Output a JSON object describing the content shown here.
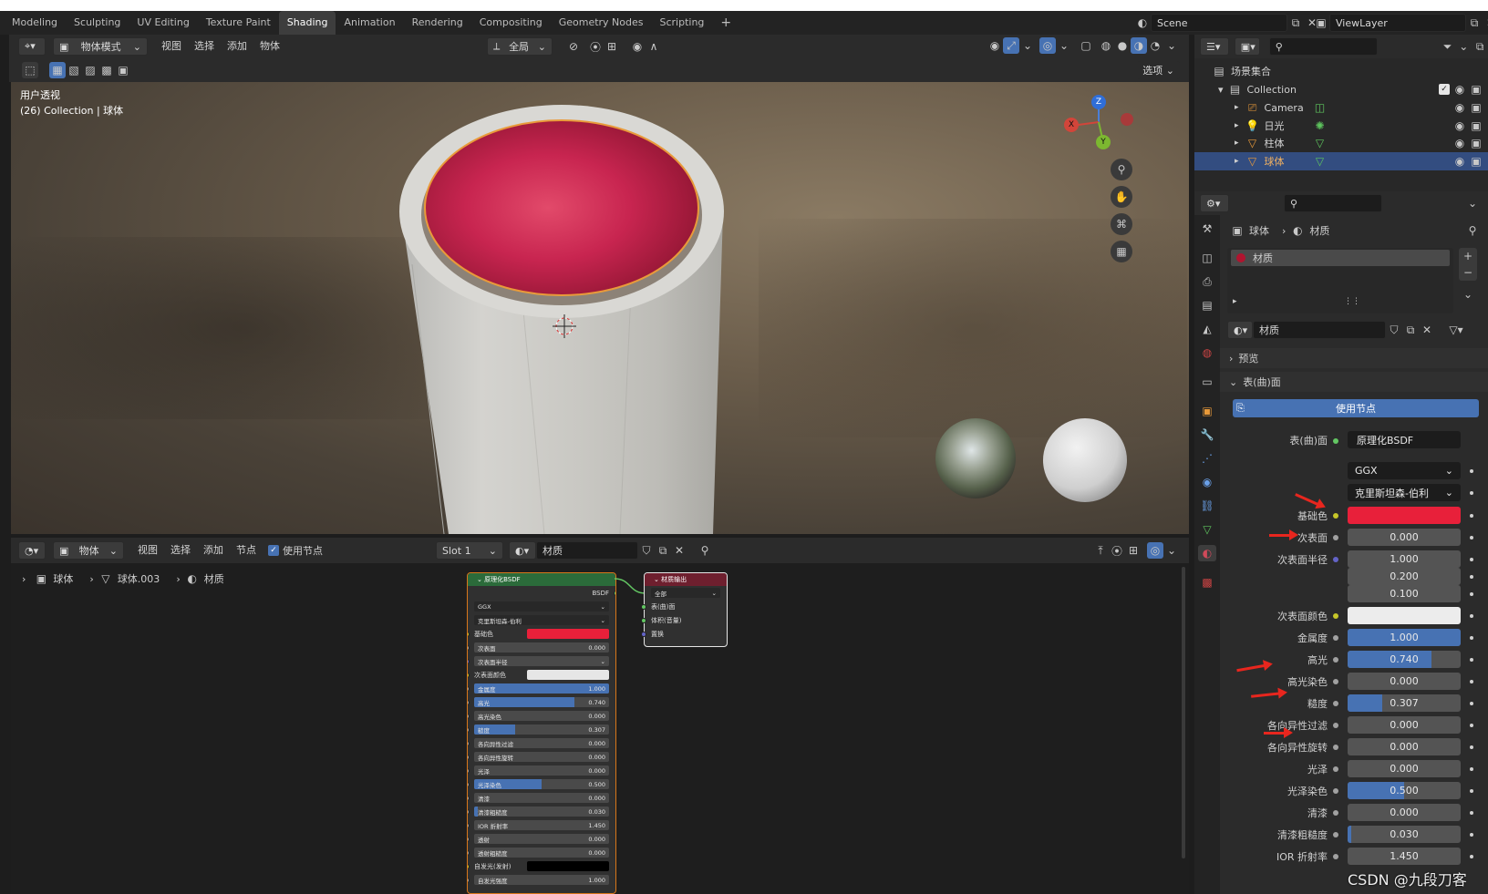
{
  "workspaces": [
    "Modeling",
    "Sculpting",
    "UV Editing",
    "Texture Paint",
    "Shading",
    "Animation",
    "Rendering",
    "Compositing",
    "Geometry Nodes",
    "Scripting"
  ],
  "active_workspace": "Shading",
  "scene": {
    "name": "Scene",
    "view_layer": "ViewLayer"
  },
  "viewport": {
    "mode": "物体模式",
    "menus": [
      "视图",
      "选择",
      "添加",
      "物体"
    ],
    "transform_orientation": "全局",
    "options_label": "选项",
    "view_name": "用户透视",
    "collection_info": "(26) Collection | 球体",
    "gizmo_axes": {
      "x": "X",
      "y": "Y",
      "z": "Z"
    }
  },
  "node_editor": {
    "type": "物体",
    "menus": [
      "视图",
      "选择",
      "添加",
      "节点"
    ],
    "use_nodes_label": "使用节点",
    "slot": "Slot 1",
    "material": "材质",
    "breadcrumb": [
      "球体",
      "球体.003",
      "材质"
    ],
    "bsdf_node": {
      "title": "原理化BSDF",
      "output": "BSDF",
      "distribution": "GGX",
      "subsurface_method": "克里斯坦森-伯利",
      "rows": [
        {
          "label": "基础色",
          "value": "",
          "kind": "color",
          "color": "#e8203a",
          "socket": "yellow"
        },
        {
          "label": "次表面",
          "value": "0.000",
          "fill": 0,
          "socket": "gray"
        },
        {
          "label": "次表面半径",
          "value": "",
          "kind": "dropdown",
          "socket": "purple"
        },
        {
          "label": "次表面颜色",
          "value": "",
          "kind": "color",
          "color": "#e6e6e6",
          "socket": "yellow"
        },
        {
          "label": "金属度",
          "value": "1.000",
          "fill": 1.0,
          "socket": "gray"
        },
        {
          "label": "高光",
          "value": "0.740",
          "fill": 0.74,
          "socket": "gray"
        },
        {
          "label": "高光染色",
          "value": "0.000",
          "fill": 0,
          "socket": "gray"
        },
        {
          "label": "糙度",
          "value": "0.307",
          "fill": 0.307,
          "socket": "gray"
        },
        {
          "label": "各向异性过滤",
          "value": "0.000",
          "fill": 0,
          "socket": "gray"
        },
        {
          "label": "各向异性旋转",
          "value": "0.000",
          "fill": 0,
          "socket": "gray"
        },
        {
          "label": "光泽",
          "value": "0.000",
          "fill": 0,
          "socket": "gray"
        },
        {
          "label": "光泽染色",
          "value": "0.500",
          "fill": 0.5,
          "socket": "gray"
        },
        {
          "label": "清漆",
          "value": "0.000",
          "fill": 0,
          "socket": "gray"
        },
        {
          "label": "清漆粗糙度",
          "value": "0.030",
          "fill": 0.03,
          "socket": "gray"
        },
        {
          "label": "IOR 折射率",
          "value": "1.450",
          "fill": 0,
          "socket": "gray"
        },
        {
          "label": "透射",
          "value": "0.000",
          "fill": 0,
          "socket": "gray"
        },
        {
          "label": "透射粗糙度",
          "value": "0.000",
          "fill": 0,
          "socket": "gray"
        },
        {
          "label": "自发光(发射)",
          "value": "",
          "kind": "color",
          "color": "#000000",
          "socket": "yellow"
        },
        {
          "label": "自发光强度",
          "value": "1.000",
          "fill": 0,
          "socket": "gray"
        }
      ]
    },
    "output_node": {
      "title": "材质输出",
      "target": "全部",
      "inputs": [
        "表(曲)面",
        "体积(音量)",
        "置换"
      ]
    }
  },
  "outliner": {
    "root": "场景集合",
    "collection": "Collection",
    "items": [
      {
        "name": "Camera",
        "icon": "camera-icon",
        "selected": false
      },
      {
        "name": "日光",
        "icon": "light-icon",
        "selected": false
      },
      {
        "name": "柱体",
        "icon": "mesh-icon",
        "selected": false
      },
      {
        "name": "球体",
        "icon": "mesh-icon",
        "selected": true
      }
    ]
  },
  "properties": {
    "breadcrumb": [
      "球体",
      "材质"
    ],
    "slot_name": "材质",
    "material_name": "材质",
    "preview_label": "预览",
    "surface_label": "表(曲)面",
    "use_nodes_button": "使用节点",
    "surface_shader": "原理化BSDF",
    "distribution": "GGX",
    "subsurface_method": "克里斯坦森-伯利",
    "rows": [
      {
        "label": "基础色",
        "kind": "color",
        "color": "#e8203a",
        "dot": "#c7c729"
      },
      {
        "label": "次表面",
        "value": "0.000",
        "fill": 0,
        "dot": "#a1a1a1"
      },
      {
        "label": "次表面半径",
        "value": "1.000",
        "fill": 0,
        "dot": "#6363c7",
        "extra": [
          "0.200",
          "0.100"
        ]
      },
      {
        "label": "次表面颜色",
        "kind": "color",
        "color": "#ececec",
        "dot": "#c7c729"
      },
      {
        "label": "金属度",
        "value": "1.000",
        "fill": 1.0,
        "dot": "#a1a1a1"
      },
      {
        "label": "高光",
        "value": "0.740",
        "fill": 0.74,
        "dot": "#a1a1a1"
      },
      {
        "label": "高光染色",
        "value": "0.000",
        "fill": 0,
        "dot": "#a1a1a1"
      },
      {
        "label": "糙度",
        "value": "0.307",
        "fill": 0.307,
        "dot": "#a1a1a1"
      },
      {
        "label": "各向异性过滤",
        "value": "0.000",
        "fill": 0,
        "dot": "#a1a1a1"
      },
      {
        "label": "各向异性旋转",
        "value": "0.000",
        "fill": 0,
        "dot": "#a1a1a1"
      },
      {
        "label": "光泽",
        "value": "0.000",
        "fill": 0,
        "dot": "#a1a1a1"
      },
      {
        "label": "光泽染色",
        "value": "0.500",
        "fill": 0.5,
        "dot": "#a1a1a1"
      },
      {
        "label": "清漆",
        "value": "0.000",
        "fill": 0,
        "dot": "#a1a1a1"
      },
      {
        "label": "清漆粗糙度",
        "value": "0.030",
        "fill": 0.03,
        "dot": "#a1a1a1"
      },
      {
        "label": "IOR 折射率",
        "value": "1.450",
        "fill": 0,
        "dot": "#a1a1a1"
      }
    ]
  },
  "watermark": "CSDN @九段刀客",
  "colors": {
    "accent": "#4772b3",
    "selection": "#334d80",
    "annotation_arrow": "#e8261e"
  }
}
